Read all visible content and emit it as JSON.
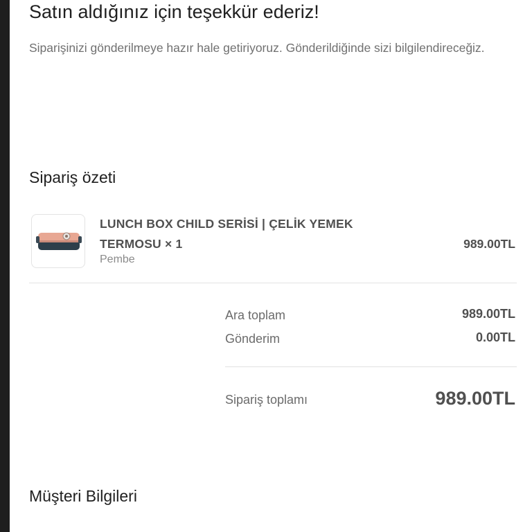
{
  "header": {
    "title": "Satın aldığınız için teşekkür ederiz!",
    "subtitle": "Siparişinizi gönderilmeye hazır hale getiriyoruz. Gönderildiğinde sizi bilgilendireceğiz."
  },
  "summary": {
    "title": "Sipariş özeti",
    "item": {
      "name": "LUNCH BOX CHILD SERİSİ | ÇELİK YEMEK TERMOSU × 1",
      "variant": "Pembe",
      "price": "989.00TL",
      "image_icon": "lunch-box-thumbnail"
    },
    "subtotal_label": "Ara toplam",
    "subtotal_value": "989.00TL",
    "shipping_label": "Gönderim",
    "shipping_value": "0.00TL",
    "total_label": "Sipariş toplamı",
    "total_value": "989.00TL"
  },
  "customer": {
    "title": "Müşteri Bilgileri"
  }
}
